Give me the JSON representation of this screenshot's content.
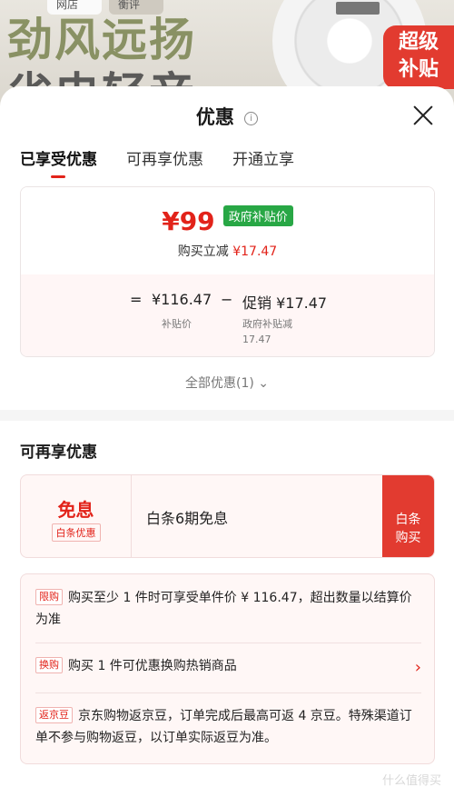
{
  "banner": {
    "chip_left": "网店",
    "chip_right": "衡评",
    "headline": "劲风远扬",
    "subline": "省电轻音",
    "badge": "超级\n补贴"
  },
  "sheet": {
    "title": "优惠",
    "info_icon": "i",
    "tabs": [
      "已享受优惠",
      "可再享优惠",
      "开通立享"
    ],
    "active_tab": 0
  },
  "price_card": {
    "currency": "¥",
    "final_price": "99",
    "gov_tag": "政府补贴价",
    "reduce_label": "购买立减",
    "reduce_amount": "¥17.47",
    "calc": {
      "eq": "=",
      "base": "¥116.47",
      "minus": "−",
      "promo": "促销 ¥17.47",
      "base_label": "补贴价",
      "promo_label": "政府补贴减\n17.47"
    }
  },
  "all_promo": "全部优惠(1)",
  "section_title": "可再享优惠",
  "baitiao": {
    "free_label": "免息",
    "tag": "白条优惠",
    "desc": "白条6期免息",
    "button": "白条\n购买"
  },
  "rules": [
    {
      "tag": "限购",
      "text": "购买至少 1 件时可享受单件价 ¥ 116.47，超出数量以结算价为准"
    },
    {
      "tag": "换购",
      "text": "购买 1 件可优惠换购热销商品",
      "arrow": "›"
    },
    {
      "tag": "返京豆",
      "text": "京东购物返京豆，订单完成后最高可返 4 京豆。特殊渠道订单不参与购物返豆，以订单实际返豆为准。"
    }
  ],
  "watermark": "什么值得买",
  "colors": {
    "accent": "#e2231a",
    "gov_green": "#28a745"
  }
}
